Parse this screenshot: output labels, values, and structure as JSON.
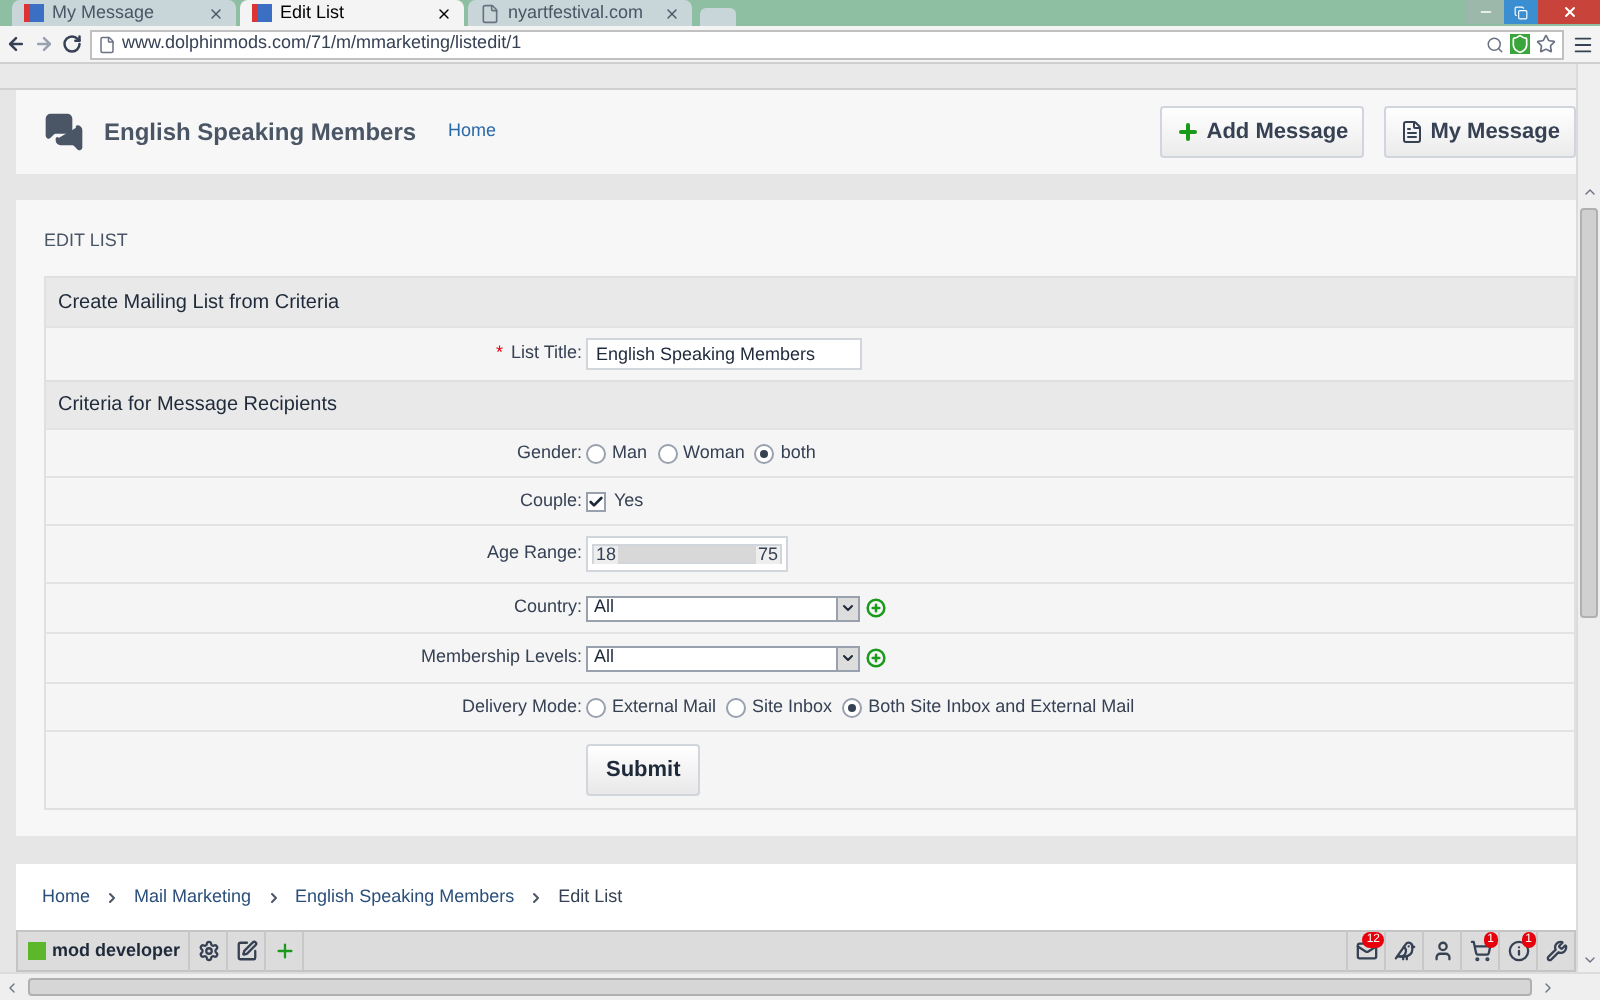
{
  "browser": {
    "tabs": [
      {
        "title": "My Message",
        "selected": false,
        "kind": "site"
      },
      {
        "title": "Edit List",
        "selected": true,
        "kind": "site"
      },
      {
        "title": "nyartfestival.com",
        "selected": false,
        "kind": "page"
      }
    ],
    "url": "www.dolphinmods.com/71/m/mmarketing/listedit/1"
  },
  "header": {
    "title": "English Speaking Members",
    "home_link": "Home",
    "buttons": [
      {
        "label": "Add Message",
        "kind": "add"
      },
      {
        "label": "My Message",
        "kind": "doc"
      }
    ]
  },
  "panel": {
    "title": "EDIT LIST",
    "sections": [
      {
        "title": "Create Mailing List from Criteria",
        "rows": [
          {
            "kind": "text",
            "label": "List Title:",
            "required_mark": "*",
            "value": "English Speaking Members"
          }
        ]
      },
      {
        "title": "Criteria for Message Recipients",
        "rows": [
          {
            "kind": "radio",
            "label": "Gender:",
            "options": [
              {
                "label": "Man",
                "selected": false
              },
              {
                "label": "Woman",
                "selected": false
              },
              {
                "label": "both",
                "selected": true
              }
            ]
          },
          {
            "kind": "checkbox",
            "label": "Couple:",
            "option": "Yes",
            "checked": true
          },
          {
            "kind": "range",
            "label": "Age Range:",
            "low": "18",
            "high": "75",
            "level": 1
          },
          {
            "kind": "select",
            "label": "Country:",
            "value": "All"
          },
          {
            "kind": "select",
            "label": "Membership Levels:",
            "value": "All"
          },
          {
            "kind": "radio",
            "label": "Delivery Mode:",
            "options": [
              {
                "label": "External Mail",
                "selected": false
              },
              {
                "label": "Site Inbox",
                "selected": false
              },
              {
                "label": "Both Site Inbox and External Mail",
                "selected": true
              }
            ]
          },
          {
            "kind": "submit",
            "label": "Submit"
          }
        ]
      }
    ]
  },
  "breadcrumb": [
    "Home",
    "Mail Marketing",
    "English Speaking Members",
    "Edit List"
  ],
  "toolbar": {
    "user": "mod developer",
    "left_tools": [
      {
        "kind": "settings"
      },
      {
        "kind": "edit"
      },
      {
        "kind": "add"
      }
    ],
    "right_tools": [
      {
        "kind": "mail",
        "badge": "12"
      },
      {
        "kind": "bird"
      },
      {
        "kind": "user"
      },
      {
        "kind": "cart",
        "badge": "1"
      },
      {
        "kind": "info",
        "badge": "1"
      },
      {
        "kind": "wrench"
      }
    ]
  }
}
